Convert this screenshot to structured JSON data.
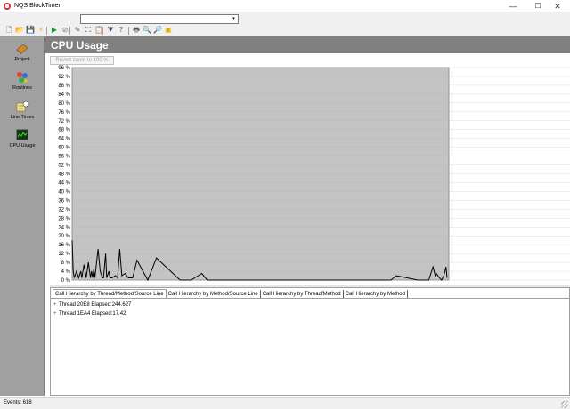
{
  "window": {
    "title": "NQS BlockTimer",
    "minimize": "—",
    "maximize": "☐",
    "close": "✕"
  },
  "combo": {
    "value": "",
    "arrow": "▾"
  },
  "toolbar": {
    "buttons": [
      {
        "name": "new-icon",
        "glyph": "🗋",
        "color": "#555555"
      },
      {
        "name": "open-folder-icon",
        "glyph": "📂",
        "color": "#d8a520"
      },
      {
        "name": "save-icon",
        "glyph": "💾",
        "color": "#2a4a9a"
      },
      {
        "name": "lightning-icon",
        "glyph": "⚡",
        "color": "#e0b000"
      },
      {
        "name": "run-icon",
        "glyph": "▶",
        "color": "#1a9a3a"
      },
      {
        "name": "stop-icon",
        "glyph": "⊘",
        "color": "#777777"
      },
      {
        "name": "pen-icon",
        "glyph": "✎",
        "color": "#555555"
      },
      {
        "name": "expand-icon",
        "glyph": "⛶",
        "color": "#333333"
      },
      {
        "name": "clipboard-icon",
        "glyph": "📋",
        "color": "#555555"
      },
      {
        "name": "filter-icon",
        "glyph": "⧩",
        "color": "#444444"
      },
      {
        "name": "help-icon",
        "glyph": "?",
        "color": "#1a5fb4"
      },
      {
        "name": "print-icon",
        "glyph": "🖶",
        "color": "#555555"
      },
      {
        "name": "zoom-in-icon",
        "glyph": "🔍",
        "color": "#333333"
      },
      {
        "name": "zoom-out-icon",
        "glyph": "🔎",
        "color": "#333333"
      },
      {
        "name": "highlight-icon",
        "glyph": "▣",
        "color": "#e0b000"
      }
    ]
  },
  "sidebar": {
    "items": [
      {
        "label": "Project"
      },
      {
        "label": "Routines"
      },
      {
        "label": "Line Times"
      },
      {
        "label": "CPU Usage"
      }
    ]
  },
  "header": {
    "title": "CPU Usage"
  },
  "chart": {
    "reset_label": "Revert zoom to 100 %"
  },
  "chart_data": {
    "type": "line",
    "title": "",
    "xlabel": "",
    "ylabel": "",
    "ylim": [
      0,
      96
    ],
    "y_ticks": [
      "96 %",
      "92 %",
      "88 %",
      "84 %",
      "80 %",
      "76 %",
      "72 %",
      "68 %",
      "64 %",
      "60 %",
      "56 %",
      "52 %",
      "48 %",
      "44 %",
      "40 %",
      "36 %",
      "32 %",
      "28 %",
      "24 %",
      "20 %",
      "16 %",
      "12 %",
      "8 %",
      "4 %",
      "0 %"
    ],
    "grid": true,
    "series": [
      {
        "x": [
          0,
          1,
          2,
          4,
          6,
          8,
          9,
          11,
          13,
          15,
          17,
          18,
          19,
          20,
          21,
          24,
          26,
          28,
          29,
          31,
          32,
          34,
          35,
          37,
          40,
          42,
          44,
          46,
          49,
          52,
          55,
          56,
          60,
          70,
          78,
          100,
          110,
          120,
          125,
          200,
          250,
          295,
          300,
          320,
          330,
          334,
          336,
          337,
          340,
          342,
          344,
          346,
          347
        ],
        "y": [
          18,
          4,
          1,
          4,
          1,
          4,
          1,
          7,
          1,
          8,
          1,
          4,
          1,
          5,
          1,
          14,
          4,
          1,
          1,
          12,
          1,
          4,
          1,
          1,
          2,
          1,
          14,
          2,
          3,
          1,
          1,
          1,
          9,
          0,
          10,
          0,
          0,
          3,
          0,
          0,
          0,
          0,
          2,
          0,
          0,
          6,
          2,
          3,
          1,
          0,
          2,
          6,
          1
        ]
      }
    ]
  },
  "tabs": [
    {
      "label": "Call Hierarchy by Thread/Method/Source Line",
      "active": true
    },
    {
      "label": "Call Hierarchy by Method/Source Line",
      "active": false
    },
    {
      "label": "Call Hierarchy by Thread/Method",
      "active": false
    },
    {
      "label": "Call Hierarchy by Method",
      "active": false
    }
  ],
  "tree": [
    {
      "text": "Thread 20E8 Elapsed:244.627"
    },
    {
      "text": "Thread 1EA4 Elapsed:17.42"
    }
  ],
  "status": {
    "text": "Events: 618"
  }
}
